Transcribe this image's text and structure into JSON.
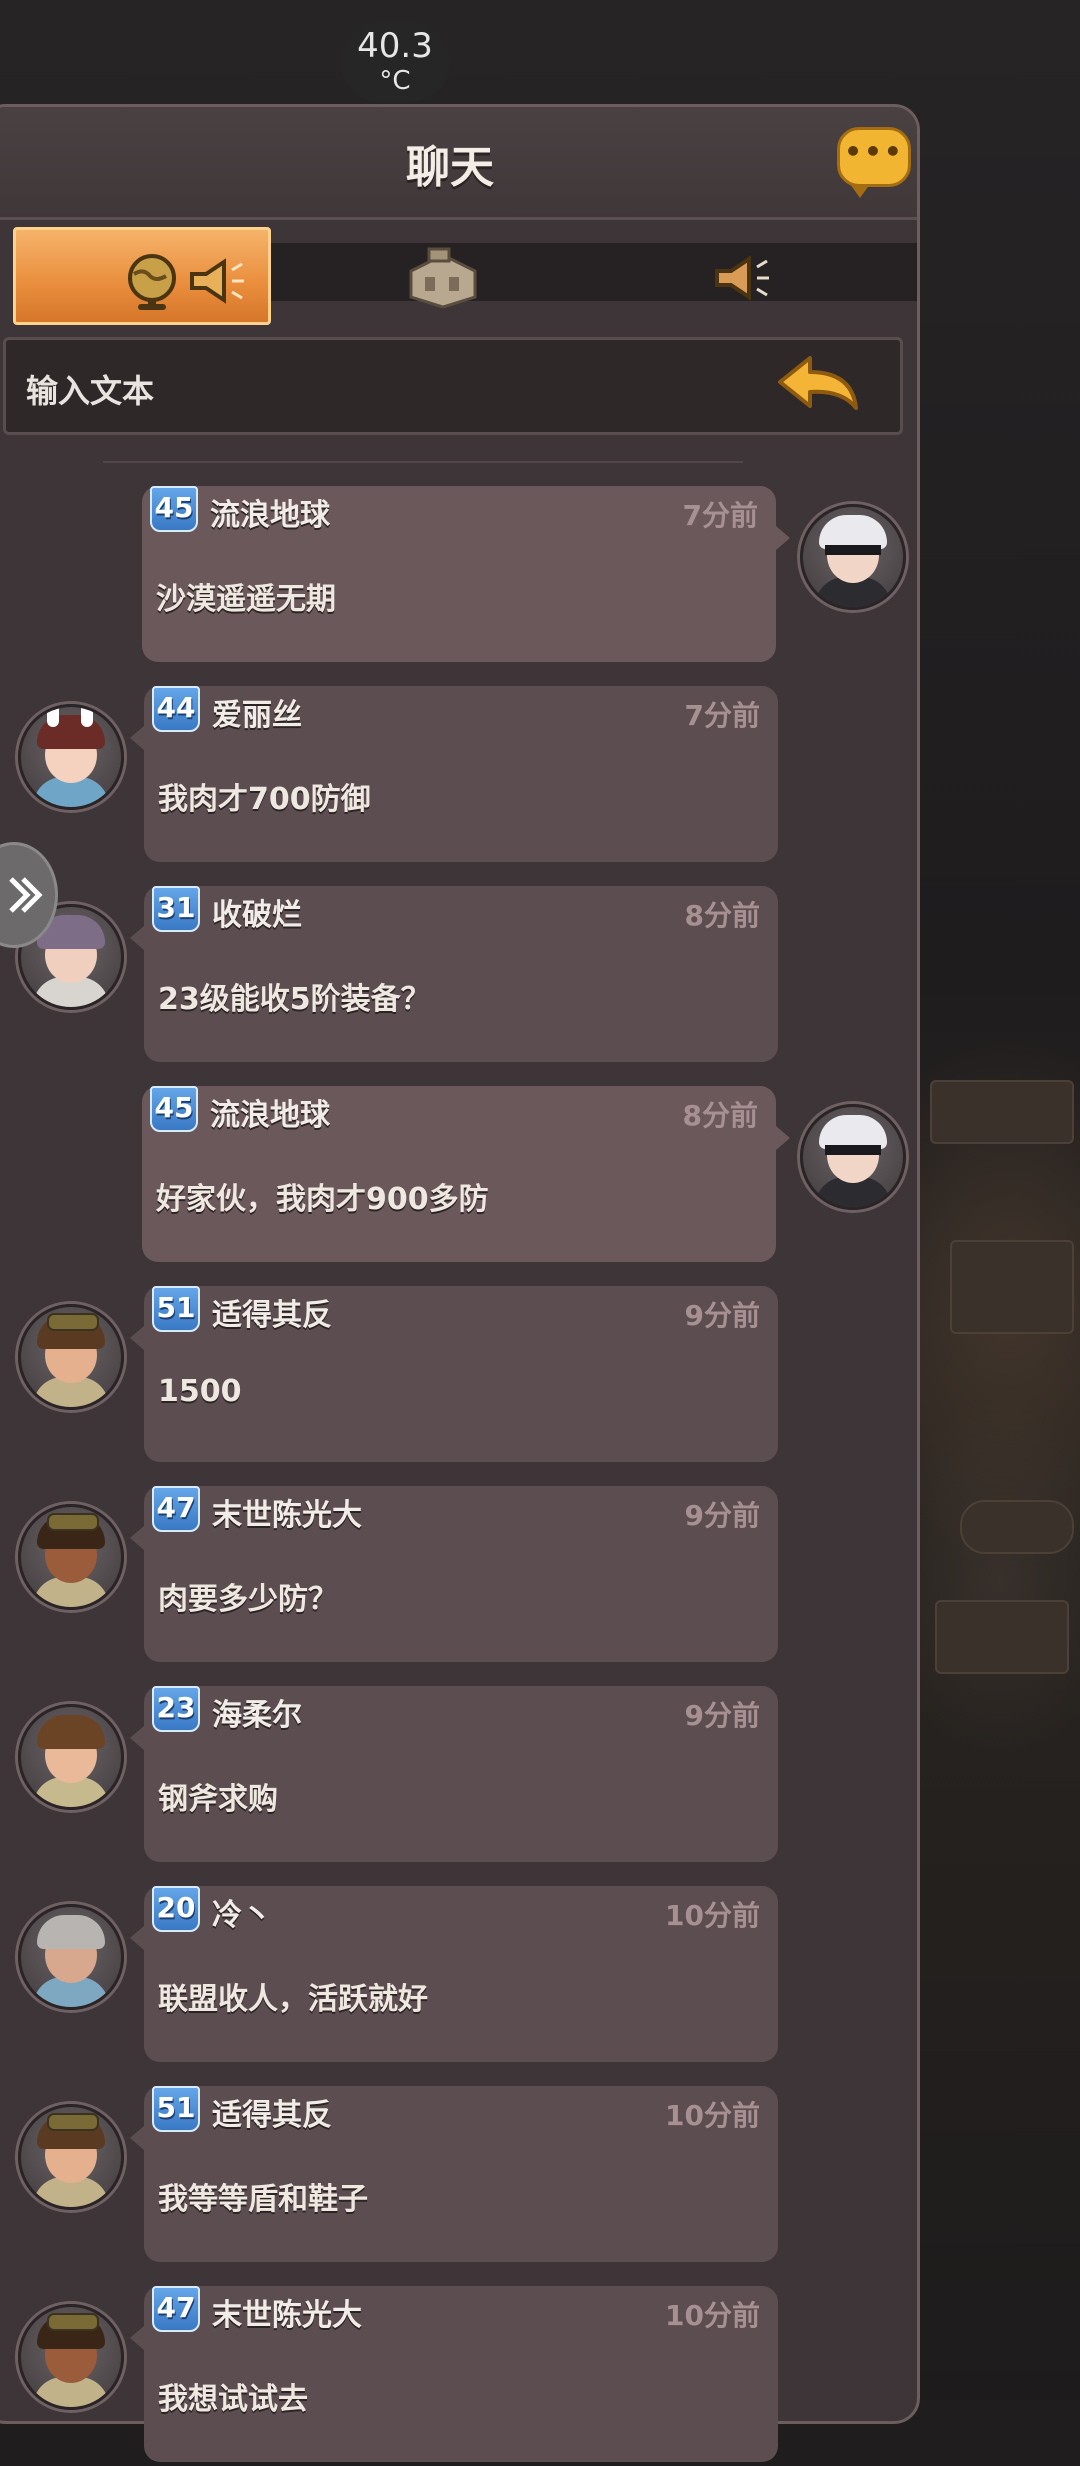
{
  "status": {
    "temperature": "40.3",
    "unit": "°C"
  },
  "header": {
    "title": "聊天",
    "chat_icon": "speech-bubble-icon"
  },
  "tabs": [
    {
      "name": "world",
      "icons": [
        "globe-icon",
        "megaphone-icon"
      ],
      "active": true
    },
    {
      "name": "alliance",
      "icons": [
        "building-icon"
      ],
      "active": false
    },
    {
      "name": "system",
      "icons": [
        "megaphone-icon"
      ],
      "active": false
    }
  ],
  "input": {
    "placeholder": "输入文本",
    "send_icon": "return-arrow-icon"
  },
  "messages": [
    {
      "level": "45",
      "name": "流浪地球",
      "time": "7分前",
      "text": "沙漠遥遥无期",
      "side": "right",
      "avatar": "white-hair-blindfold"
    },
    {
      "level": "44",
      "name": "爱丽丝",
      "time": "7分前",
      "text": "我肉才700防御",
      "side": "left",
      "avatar": "bunny-ears-girl"
    },
    {
      "level": "31",
      "name": "收破烂",
      "time": "8分前",
      "text": "23级能收5阶装备？",
      "side": "left",
      "avatar": "purple-hair-woman"
    },
    {
      "level": "45",
      "name": "流浪地球",
      "time": "8分前",
      "text": "好家伙，我肉才900多防",
      "side": "right",
      "avatar": "white-hair-blindfold"
    },
    {
      "level": "51",
      "name": "适得其反",
      "time": "9分前",
      "text": "1500",
      "side": "left",
      "avatar": "goggles-man"
    },
    {
      "level": "47",
      "name": "末世陈光大",
      "time": "9分前",
      "text": "肉要多少防？",
      "side": "left",
      "avatar": "goggles-dark-man"
    },
    {
      "level": "23",
      "name": "海柔尔",
      "time": "9分前",
      "text": "钢斧求购",
      "side": "left",
      "avatar": "brown-hair-man"
    },
    {
      "level": "20",
      "name": "冷丶",
      "time": "10分前",
      "text": "联盟收人，活跃就好",
      "side": "left",
      "avatar": "grey-hair-man"
    },
    {
      "level": "51",
      "name": "适得其反",
      "time": "10分前",
      "text": "我等等盾和鞋子",
      "side": "left",
      "avatar": "goggles-man"
    },
    {
      "level": "47",
      "name": "末世陈光大",
      "time": "10分前",
      "text": "我想试试去",
      "side": "left",
      "avatar": "goggles-dark-man"
    }
  ],
  "colors": {
    "panel": "#3d3537",
    "bubble": "#5c4d50",
    "level_badge": "#4a8ad6",
    "active_tab": "#ee9a4a",
    "accent_gold": "#f2b531"
  }
}
